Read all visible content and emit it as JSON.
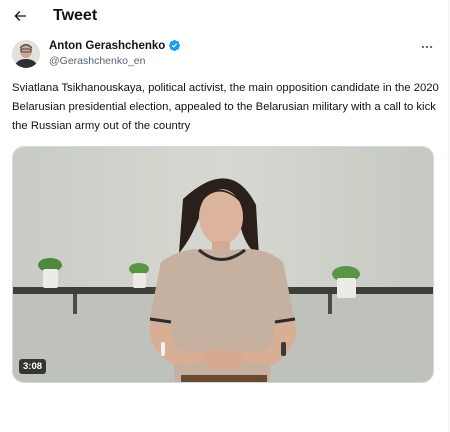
{
  "header": {
    "title": "Tweet",
    "back_icon": "arrow-left-icon"
  },
  "tweet": {
    "author": {
      "display_name": "Anton Gerashchenko",
      "handle": "@Gerashchenko_en",
      "verified": true,
      "verified_color": "#1d9bf0"
    },
    "more_icon": "more-horizontal-icon",
    "text": "Sviatlana Tsikhanouskaya, political activist, the main opposition candidate in the 2020 Belarusian presidential election, appealed to the Belarusian military with a call to kick the Russian army out of the country",
    "media": {
      "type": "video",
      "duration": "3:08"
    }
  },
  "colors": {
    "text_primary": "#0f1419",
    "text_secondary": "#536471",
    "border": "#cfd9de"
  }
}
